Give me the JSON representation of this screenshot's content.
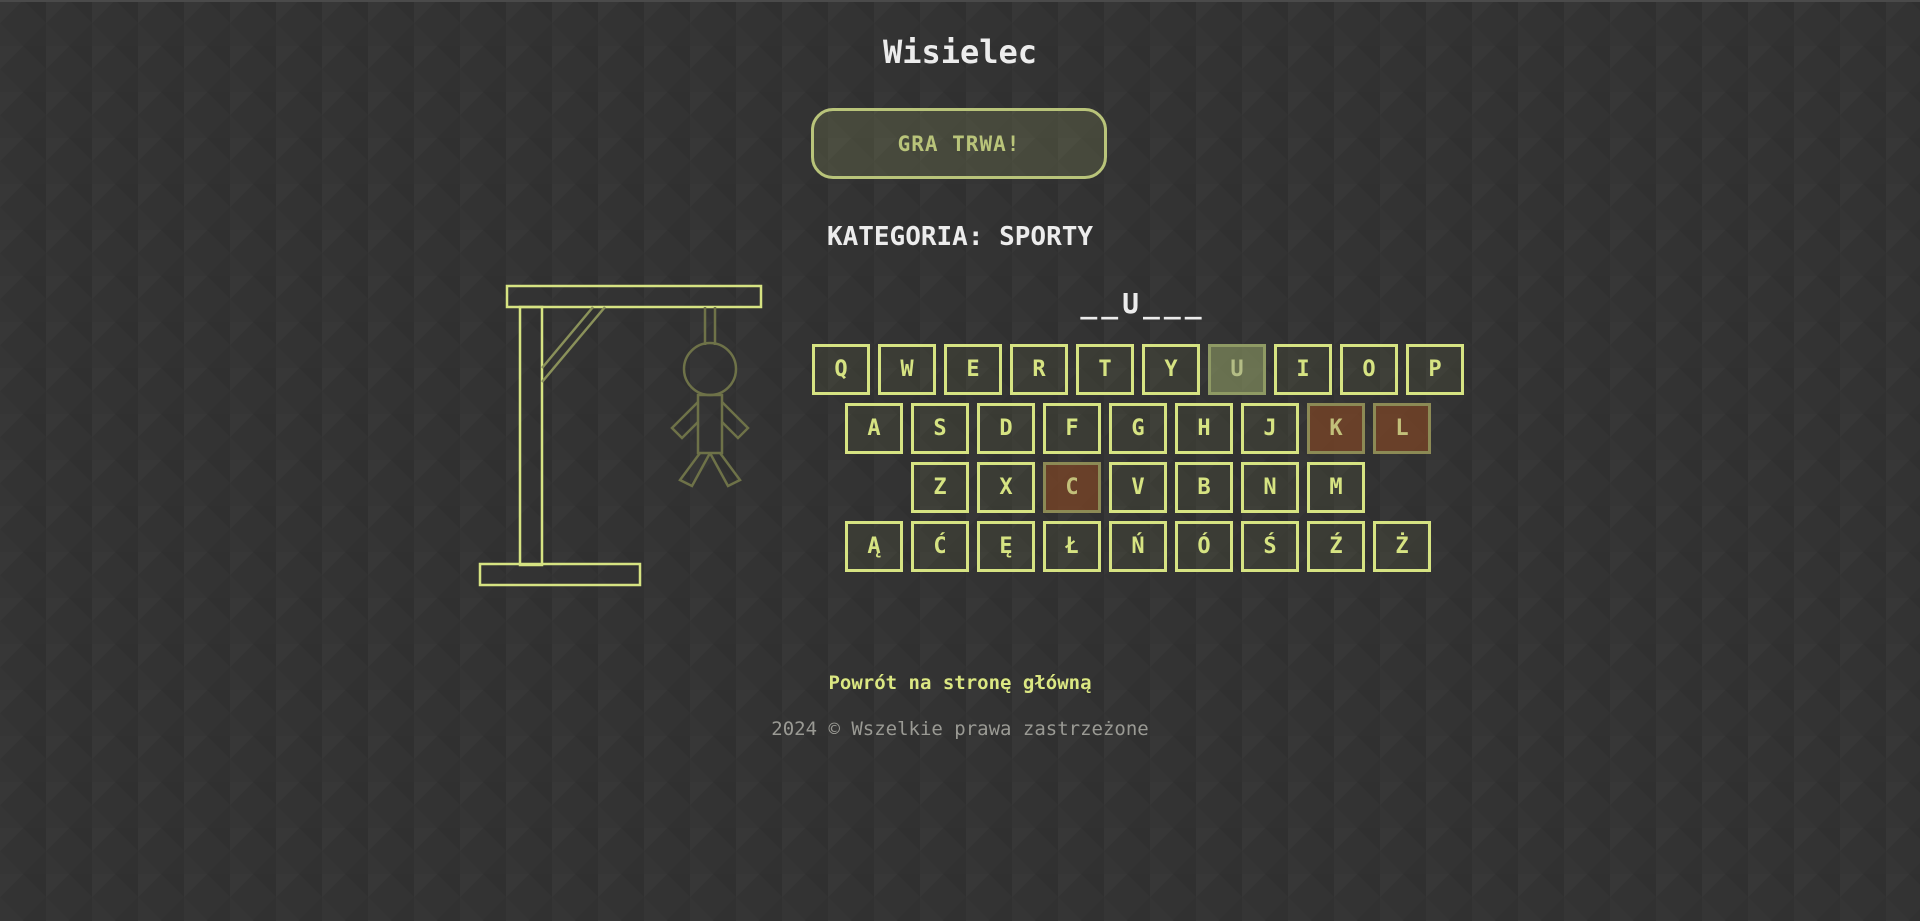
{
  "game": {
    "title": "Wisielec",
    "status": "GRA TRWA!",
    "category": "KATEGORIA: SPORTY",
    "word_display": "__U___",
    "mistakes_shown": 3,
    "mistakes_total": 6
  },
  "keyboard": {
    "rows": [
      [
        {
          "label": "Q",
          "state": "unused"
        },
        {
          "label": "W",
          "state": "unused"
        },
        {
          "label": "E",
          "state": "unused"
        },
        {
          "label": "R",
          "state": "unused"
        },
        {
          "label": "T",
          "state": "unused"
        },
        {
          "label": "Y",
          "state": "unused"
        },
        {
          "label": "U",
          "state": "correct"
        },
        {
          "label": "I",
          "state": "unused"
        },
        {
          "label": "O",
          "state": "unused"
        },
        {
          "label": "P",
          "state": "unused"
        }
      ],
      [
        {
          "label": "A",
          "state": "unused"
        },
        {
          "label": "S",
          "state": "unused"
        },
        {
          "label": "D",
          "state": "unused"
        },
        {
          "label": "F",
          "state": "unused"
        },
        {
          "label": "G",
          "state": "unused"
        },
        {
          "label": "H",
          "state": "unused"
        },
        {
          "label": "J",
          "state": "unused"
        },
        {
          "label": "K",
          "state": "wrong"
        },
        {
          "label": "L",
          "state": "wrong"
        }
      ],
      [
        {
          "label": "Z",
          "state": "unused"
        },
        {
          "label": "X",
          "state": "unused"
        },
        {
          "label": "C",
          "state": "wrong"
        },
        {
          "label": "V",
          "state": "unused"
        },
        {
          "label": "B",
          "state": "unused"
        },
        {
          "label": "N",
          "state": "unused"
        },
        {
          "label": "M",
          "state": "unused"
        }
      ],
      [
        {
          "label": "Ą",
          "state": "unused"
        },
        {
          "label": "Ć",
          "state": "unused"
        },
        {
          "label": "Ę",
          "state": "unused"
        },
        {
          "label": "Ł",
          "state": "unused"
        },
        {
          "label": "Ń",
          "state": "unused"
        },
        {
          "label": "Ó",
          "state": "unused"
        },
        {
          "label": "Ś",
          "state": "unused"
        },
        {
          "label": "Ź",
          "state": "unused"
        },
        {
          "label": "Ż",
          "state": "unused"
        }
      ]
    ]
  },
  "footer": {
    "back_link": "Powrót na stronę główną",
    "copyright": "2024 © Wszelkie prawa zastrzeżone"
  },
  "colors": {
    "background": "#333333",
    "accent": "#d6e382",
    "status_border": "#b9c47a",
    "correct_key": "#8f9a64",
    "wrong_key": "#784426",
    "figure_faded": "#6e7248",
    "footer_text": "#9a9a94"
  }
}
